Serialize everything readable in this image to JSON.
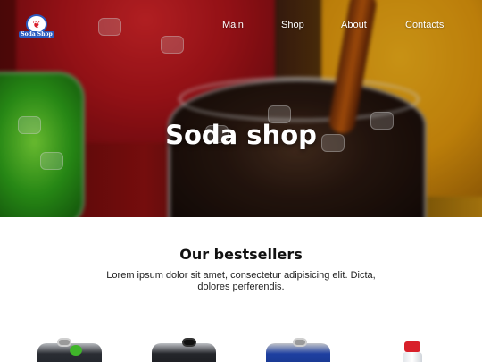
{
  "header": {
    "logo_text": "Soda Shop",
    "nav": [
      {
        "label": "Main"
      },
      {
        "label": "Shop"
      },
      {
        "label": "About"
      },
      {
        "label": "Contacts"
      }
    ]
  },
  "hero": {
    "title": "Soda shop"
  },
  "bestsellers": {
    "title": "Our bestsellers",
    "description": "Lorem ipsum dolor sit amet, consectetur adipisicing elit. Dicta, dolores perferendis."
  },
  "colors": {
    "cola": "#2a1810",
    "red_soda": "#b3151b",
    "orange_soda": "#e59a0d",
    "green_soda": "#2fa51a",
    "logo_blue": "#2b5bbf"
  }
}
